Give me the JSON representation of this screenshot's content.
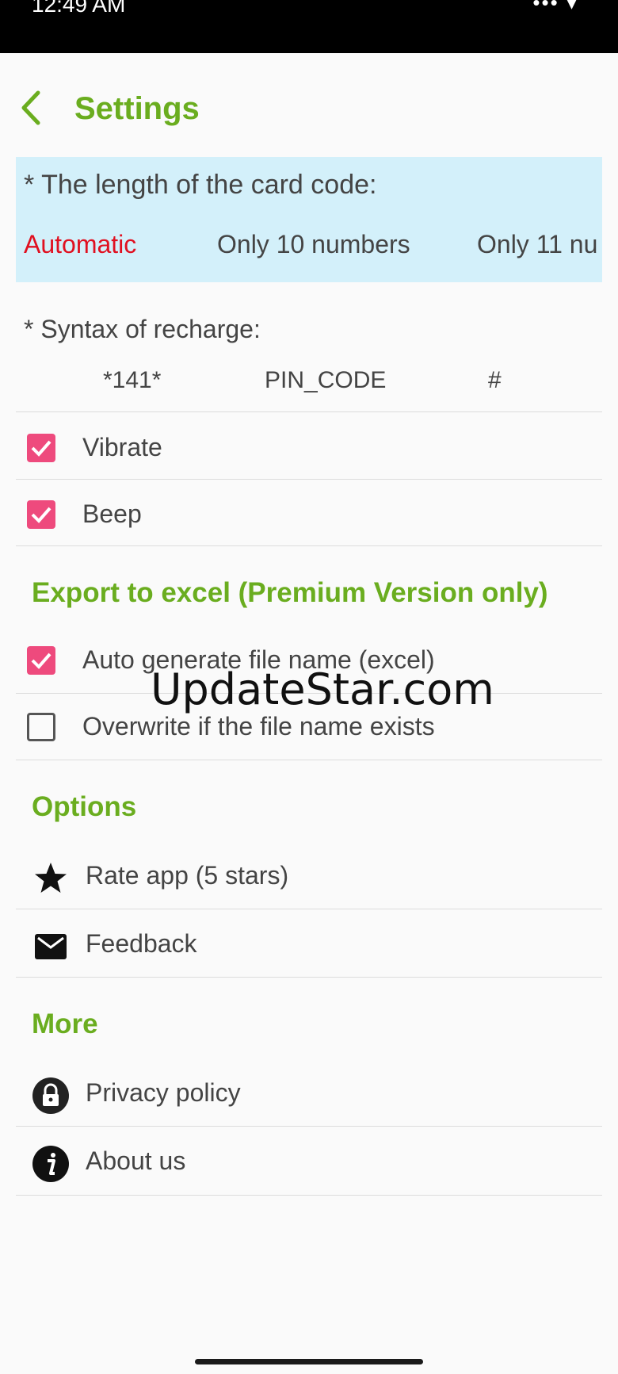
{
  "status_bar": {
    "time": "12:49 AM",
    "indicators": "••• ▾"
  },
  "header": {
    "back_icon": "chevron-left-icon",
    "title": "Settings"
  },
  "card_code": {
    "label": "* The length of the card code:",
    "options": [
      "Automatic",
      "Only 10 numbers",
      "Only 11 nu"
    ],
    "selected": "Automatic"
  },
  "syntax": {
    "label": "* Syntax of recharge:",
    "parts": [
      "*141*",
      "PIN_CODE",
      "#"
    ]
  },
  "toggles": [
    {
      "label": "Vibrate",
      "checked": true
    },
    {
      "label": "Beep",
      "checked": true
    }
  ],
  "export": {
    "title": "Export to excel (Premium Version only)",
    "items": [
      {
        "label": "Auto generate file name (excel)",
        "checked": true
      },
      {
        "label": "Overwrite if the file name exists",
        "checked": false
      }
    ]
  },
  "options": {
    "title": "Options",
    "items": [
      {
        "label": "Rate app (5 stars)",
        "icon": "star-icon"
      },
      {
        "label": "Feedback",
        "icon": "mail-icon"
      }
    ]
  },
  "more": {
    "title": "More",
    "items": [
      {
        "label": "Privacy policy",
        "icon": "lock-icon"
      },
      {
        "label": "About us",
        "icon": "info-icon"
      }
    ]
  },
  "watermark": "UpdateStar.com",
  "colors": {
    "accent": "#6aad1f",
    "selected": "#e01020",
    "checkbox": "#ee4a7d",
    "card_bg": "#d3f0fa"
  }
}
